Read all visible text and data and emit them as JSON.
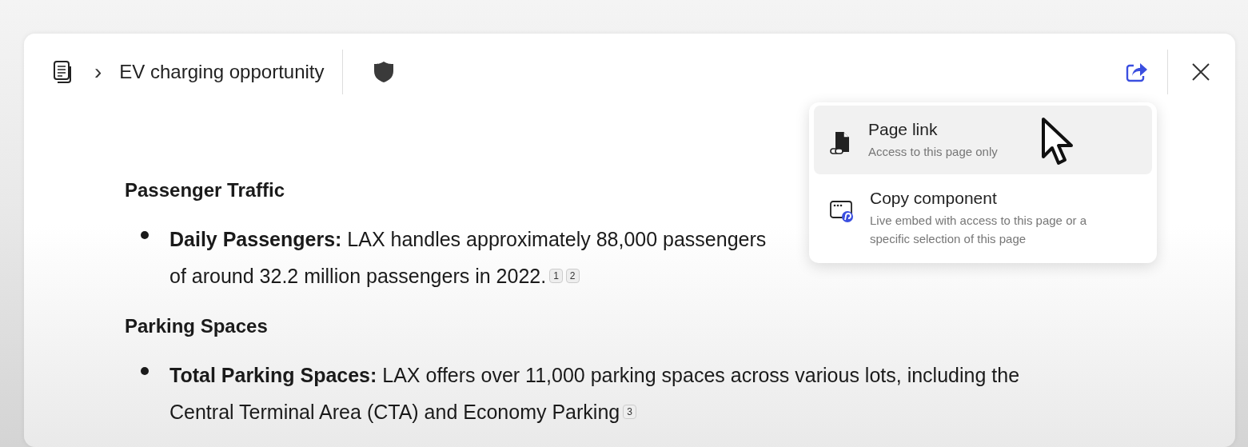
{
  "header": {
    "breadcrumb_separator": "›",
    "title": "EV charging opportunity"
  },
  "share_menu": {
    "items": [
      {
        "kind": "page-link",
        "label": "Page link",
        "description": "Access to this page only",
        "selected": true
      },
      {
        "kind": "component",
        "label": "Copy component",
        "description": "Live embed with access to this page or a specific selection of this page",
        "selected": false
      }
    ]
  },
  "sections": [
    {
      "heading": "Passenger Traffic",
      "bullets": [
        {
          "term": "Daily Passengers:",
          "lines": [
            "LAX handles approximately 88,000 passengers",
            "of around 32.2 million passengers in 2022."
          ],
          "citations": [
            "1",
            "2"
          ]
        }
      ]
    },
    {
      "heading": "Parking Spaces",
      "bullets": [
        {
          "term": "Total Parking Spaces:",
          "lines": [
            "LAX offers over 11,000 parking spaces across various lots, including the",
            "Central Terminal Area (CTA) and Economy Parking"
          ],
          "citations": [
            "3"
          ]
        }
      ]
    }
  ]
}
